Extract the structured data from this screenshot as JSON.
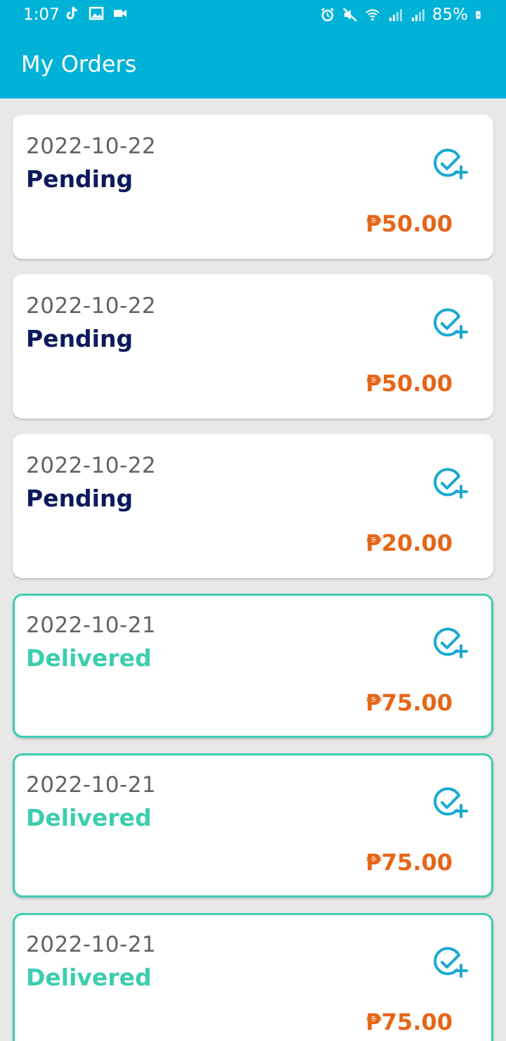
{
  "status_bar": {
    "time": "1:07",
    "battery": "85%",
    "left_icons": [
      "tiktok-icon",
      "image-icon",
      "video-icon"
    ],
    "right_icons": [
      "alarm-icon",
      "mute-icon",
      "wifi-icon",
      "signal-icon",
      "signal-icon",
      "battery-icon"
    ]
  },
  "app_bar": {
    "title": "My Orders"
  },
  "colors": {
    "app_bar": "#00b2d8",
    "pending_status": "#0d1a5c",
    "delivered_status": "#3ccdb0",
    "price": "#e66516",
    "icon": "#19a9d1"
  },
  "orders": [
    {
      "date": "2022-10-22",
      "status": "Pending",
      "price": "₱50.00",
      "action_icon": "check-plus-icon"
    },
    {
      "date": "2022-10-22",
      "status": "Pending",
      "price": "₱50.00",
      "action_icon": "check-plus-icon"
    },
    {
      "date": "2022-10-22",
      "status": "Pending",
      "price": "₱20.00",
      "action_icon": "check-plus-icon"
    },
    {
      "date": "2022-10-21",
      "status": "Delivered",
      "price": "₱75.00",
      "action_icon": "check-plus-icon"
    },
    {
      "date": "2022-10-21",
      "status": "Delivered",
      "price": "₱75.00",
      "action_icon": "check-plus-icon"
    },
    {
      "date": "2022-10-21",
      "status": "Delivered",
      "price": "₱75.00",
      "action_icon": "check-plus-icon"
    }
  ]
}
